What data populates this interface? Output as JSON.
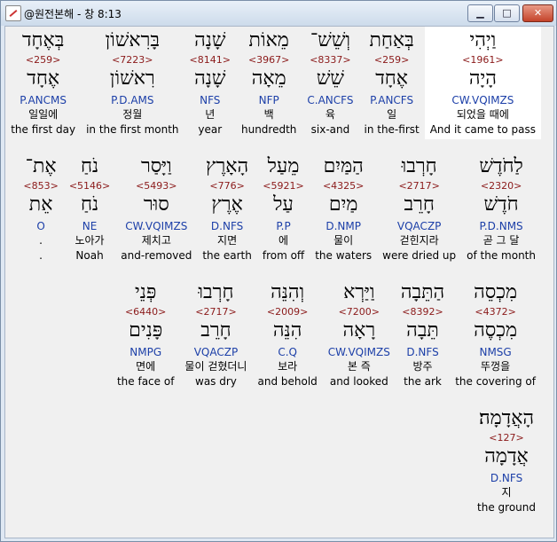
{
  "window": {
    "title": "@원전본해 - 창 8:13",
    "minimize_label": "▁",
    "maximize_label": "□",
    "close_label": "✕"
  },
  "rows": [
    [
      {
        "heb": "וַיְהִי",
        "strong": "<1961>",
        "lemma": "הָיָה",
        "morph": "CW.VQIMZS",
        "kor": "되었을 때에",
        "eng": "And it came to pass",
        "highlight": true
      },
      {
        "heb": "בְּאַחַת",
        "strong": "<259>",
        "lemma": "אֶחָד",
        "morph": "P.ANCFS",
        "kor": "일",
        "eng": "in the-first"
      },
      {
        "heb": "וְשֵׁשׁ־",
        "strong": "<8337>",
        "lemma": "שֵׁשׁ",
        "morph": "C.ANCFS",
        "kor": "육",
        "eng": "six-and"
      },
      {
        "heb": "מֵאוֹת",
        "strong": "<3967>",
        "lemma": "מֵאָה",
        "morph": "NFP",
        "kor": "백",
        "eng": "hundredth"
      },
      {
        "heb": "שָׁנָה",
        "strong": "<8141>",
        "lemma": "שָׁנָה",
        "morph": "NFS",
        "kor": "년",
        "eng": "year"
      },
      {
        "heb": "בָּרִאשׁוֹן",
        "strong": "<7223>",
        "lemma": "רִאשׁוֹן",
        "morph": "P.D.AMS",
        "kor": "정월",
        "eng": "in the first month"
      },
      {
        "heb": "בְּאֶחָד",
        "strong": "<259>",
        "lemma": "אֶחָד",
        "morph": "P.ANCMS",
        "kor": "일일에",
        "eng": "the first day"
      }
    ],
    [
      {
        "heb": "לַחֹדֶשׁ",
        "strong": "<2320>",
        "lemma": "חֹדֶשׁ",
        "morph": "P.D.NMS",
        "kor": "곧 그 달",
        "eng": "of the month"
      },
      {
        "heb": "חָרְבוּ",
        "strong": "<2717>",
        "lemma": "חָרֵב",
        "morph": "VQACZP",
        "kor": "걷힌지라",
        "eng": "were dried up"
      },
      {
        "heb": "הַמַּיִם",
        "strong": "<4325>",
        "lemma": "מַיִם",
        "morph": "D.NMP",
        "kor": "물이",
        "eng": "the waters"
      },
      {
        "heb": "מֵעַל",
        "strong": "<5921>",
        "lemma": "עַל",
        "morph": "P.P",
        "kor": "에",
        "eng": "from off"
      },
      {
        "heb": "הָאָרֶץ",
        "strong": "<776>",
        "lemma": "אֶרֶץ",
        "morph": "D.NFS",
        "kor": "지면",
        "eng": "the earth"
      },
      {
        "heb": "וַיָּסַר",
        "strong": "<5493>",
        "lemma": "סוּר",
        "morph": "CW.VQIMZS",
        "kor": "제치고",
        "eng": "and-removed"
      },
      {
        "heb": "נֹחַ",
        "strong": "<5146>",
        "lemma": "נֹחַ",
        "morph": "NE",
        "kor": "노아가",
        "eng": "Noah"
      },
      {
        "heb": "אֶת־",
        "strong": "<853>",
        "lemma": "אֵת",
        "morph": "O",
        "kor": ".",
        "eng": "."
      }
    ],
    [
      {
        "heb": "מִכְסֵה",
        "strong": "<4372>",
        "lemma": "מִכְסֶה",
        "morph": "NMSG",
        "kor": "뚜껑을",
        "eng": "the covering of"
      },
      {
        "heb": "הַתֵּבָה",
        "strong": "<8392>",
        "lemma": "תֵּבָה",
        "morph": "D.NFS",
        "kor": "방주",
        "eng": "the ark"
      },
      {
        "heb": "וַיַּרְא",
        "strong": "<7200>",
        "lemma": "רָאָה",
        "morph": "CW.VQIMZS",
        "kor": "본 즉",
        "eng": "and looked"
      },
      {
        "heb": "וְהִנֵּה",
        "strong": "<2009>",
        "lemma": "הִנֵּה",
        "morph": "C.Q",
        "kor": "보라",
        "eng": "and behold"
      },
      {
        "heb": "חָרְבוּ",
        "strong": "<2717>",
        "lemma": "חָרֵב",
        "morph": "VQACZP",
        "kor": "물이 걷혔더니",
        "eng": "was dry"
      },
      {
        "heb": "פְּנֵי",
        "strong": "<6440>",
        "lemma": "פָּנִים",
        "morph": "NMPG",
        "kor": "면에",
        "eng": "the face of"
      }
    ],
    [
      {
        "heb": "הָאֲדָמָה׃",
        "strong": "<127>",
        "lemma": "אֲדָמָה",
        "morph": "D.NFS",
        "kor": "지",
        "eng": "the ground"
      }
    ]
  ]
}
